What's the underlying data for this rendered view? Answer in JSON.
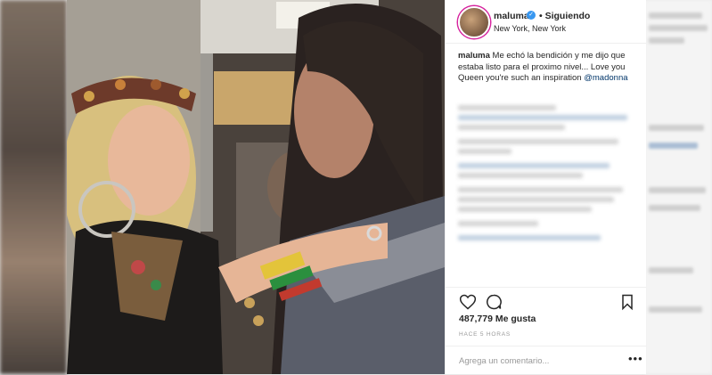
{
  "post": {
    "username": "maluma",
    "verified_glyph": "✓",
    "follow_status": "• Siguiendo",
    "location": "New York, New York",
    "caption_user": "maluma",
    "caption_text": "Me echó la bendición y me dijo que estaba listo para el proximo nivel... Love you Queen you're such an inspiration",
    "caption_mention": "@madonna",
    "likes": "487,779 Me gusta",
    "timestamp": "HACE 5 HORAS",
    "comment_placeholder": "Agrega un comentario...",
    "more_glyph": "•••"
  },
  "icons": {
    "like": "heart-icon",
    "comment": "comment-icon",
    "save": "bookmark-icon",
    "options": "more-options-icon"
  },
  "colors": {
    "verified": "#3897f0",
    "text": "#262626",
    "muted": "#999999",
    "mention": "#003569",
    "story_ring": "#d6249f"
  }
}
